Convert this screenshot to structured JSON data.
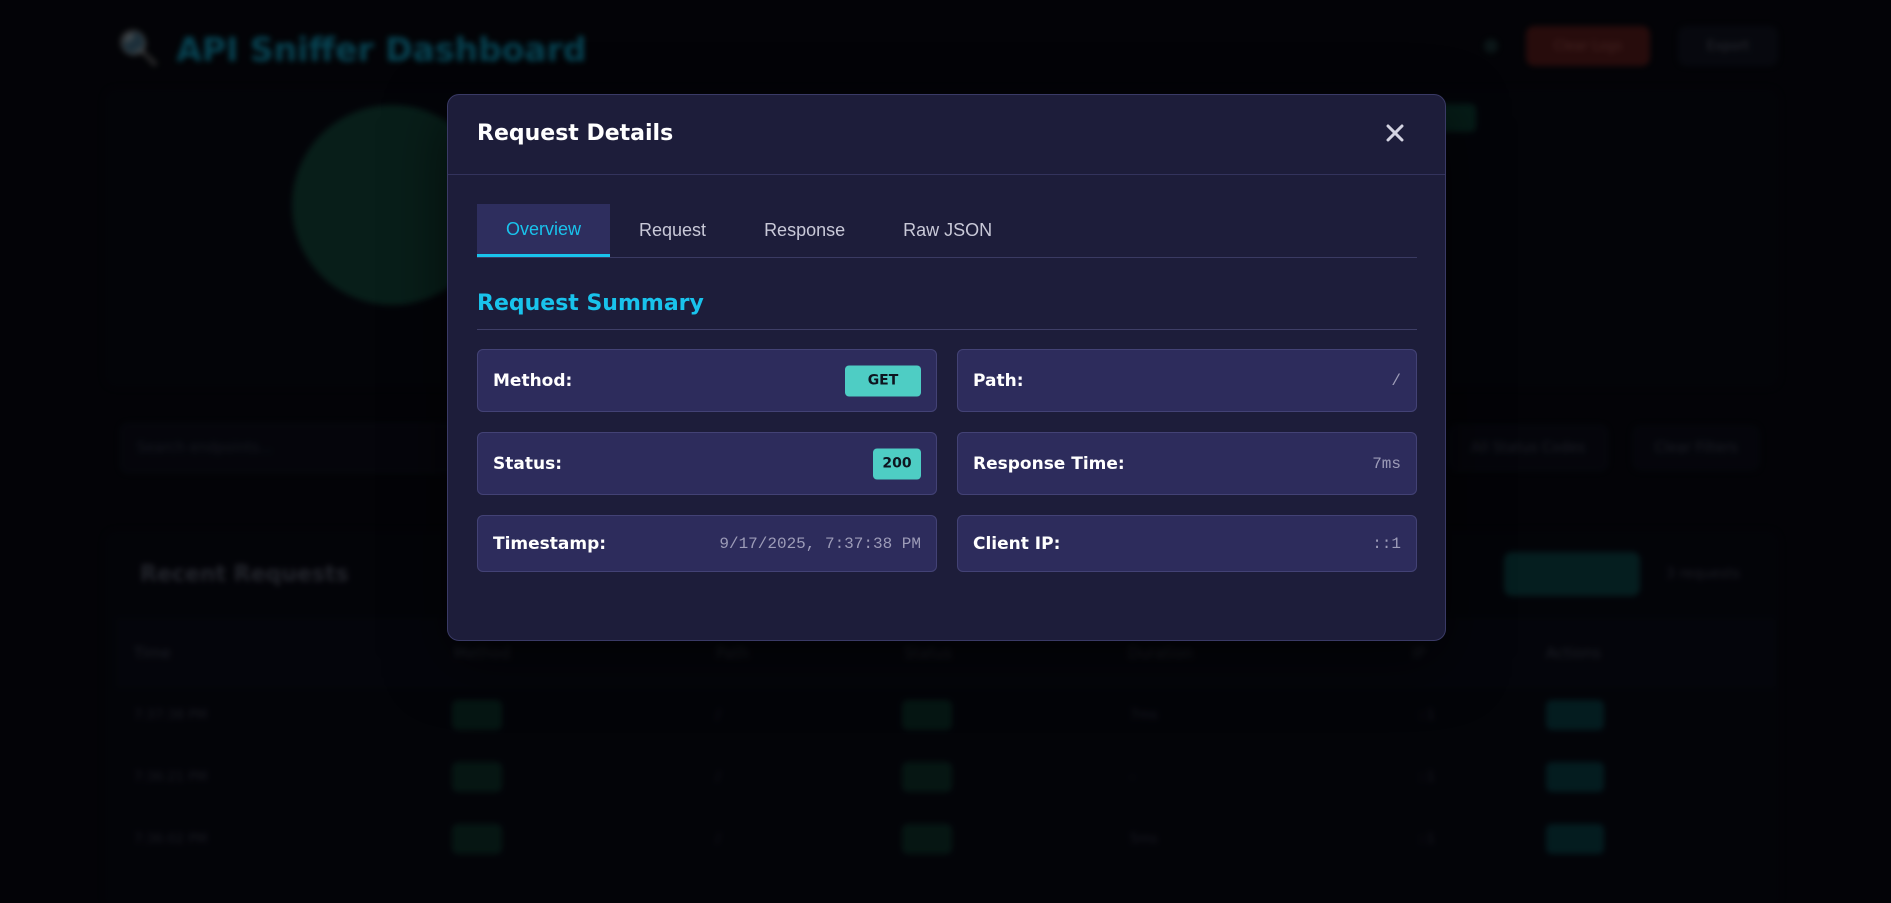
{
  "background": {
    "logo_icon": "magnifier-icon",
    "title": "API Sniffer Dashboard",
    "header_buttons": [
      "Clear Logs",
      "Export"
    ],
    "search_placeholder": "Search endpoints...",
    "filter_select": "All Status Codes",
    "clear_filters": "Clear Filters",
    "requests_title": "Recent Requests",
    "requests_count": "3 requests",
    "table_headers": [
      "Time",
      "Method",
      "Path",
      "Status",
      "Duration",
      "IP",
      "Actions"
    ],
    "rows": [
      {
        "time": "7:37:38 PM",
        "path": "/",
        "duration": "7ms",
        "ip": "::1"
      },
      {
        "time": "7:36:21 PM",
        "path": "/",
        "duration": "-",
        "ip": "::1"
      },
      {
        "time": "7:36:02 PM",
        "path": "/",
        "duration": "5ms",
        "ip": "::1"
      }
    ]
  },
  "modal": {
    "title": "Request Details",
    "close_icon": "close-icon",
    "tabs": [
      {
        "label": "Overview",
        "active": true
      },
      {
        "label": "Request",
        "active": false
      },
      {
        "label": "Response",
        "active": false
      },
      {
        "label": "Raw JSON",
        "active": false
      }
    ],
    "section_title": "Request Summary",
    "fields": {
      "method": {
        "label": "Method:",
        "value": "GET"
      },
      "path": {
        "label": "Path:",
        "value": "/"
      },
      "status": {
        "label": "Status:",
        "value": "200"
      },
      "response_time": {
        "label": "Response Time:",
        "value": "7ms"
      },
      "timestamp": {
        "label": "Timestamp:",
        "value": "9/17/2025, 7:37:38 PM"
      },
      "client_ip": {
        "label": "Client IP:",
        "value": "::1"
      }
    }
  },
  "colors": {
    "accent": "#19c3ec",
    "badge": "#4ecdc4",
    "modal_bg": "#1d1d3a",
    "card_bg": "#2d2c5c"
  }
}
